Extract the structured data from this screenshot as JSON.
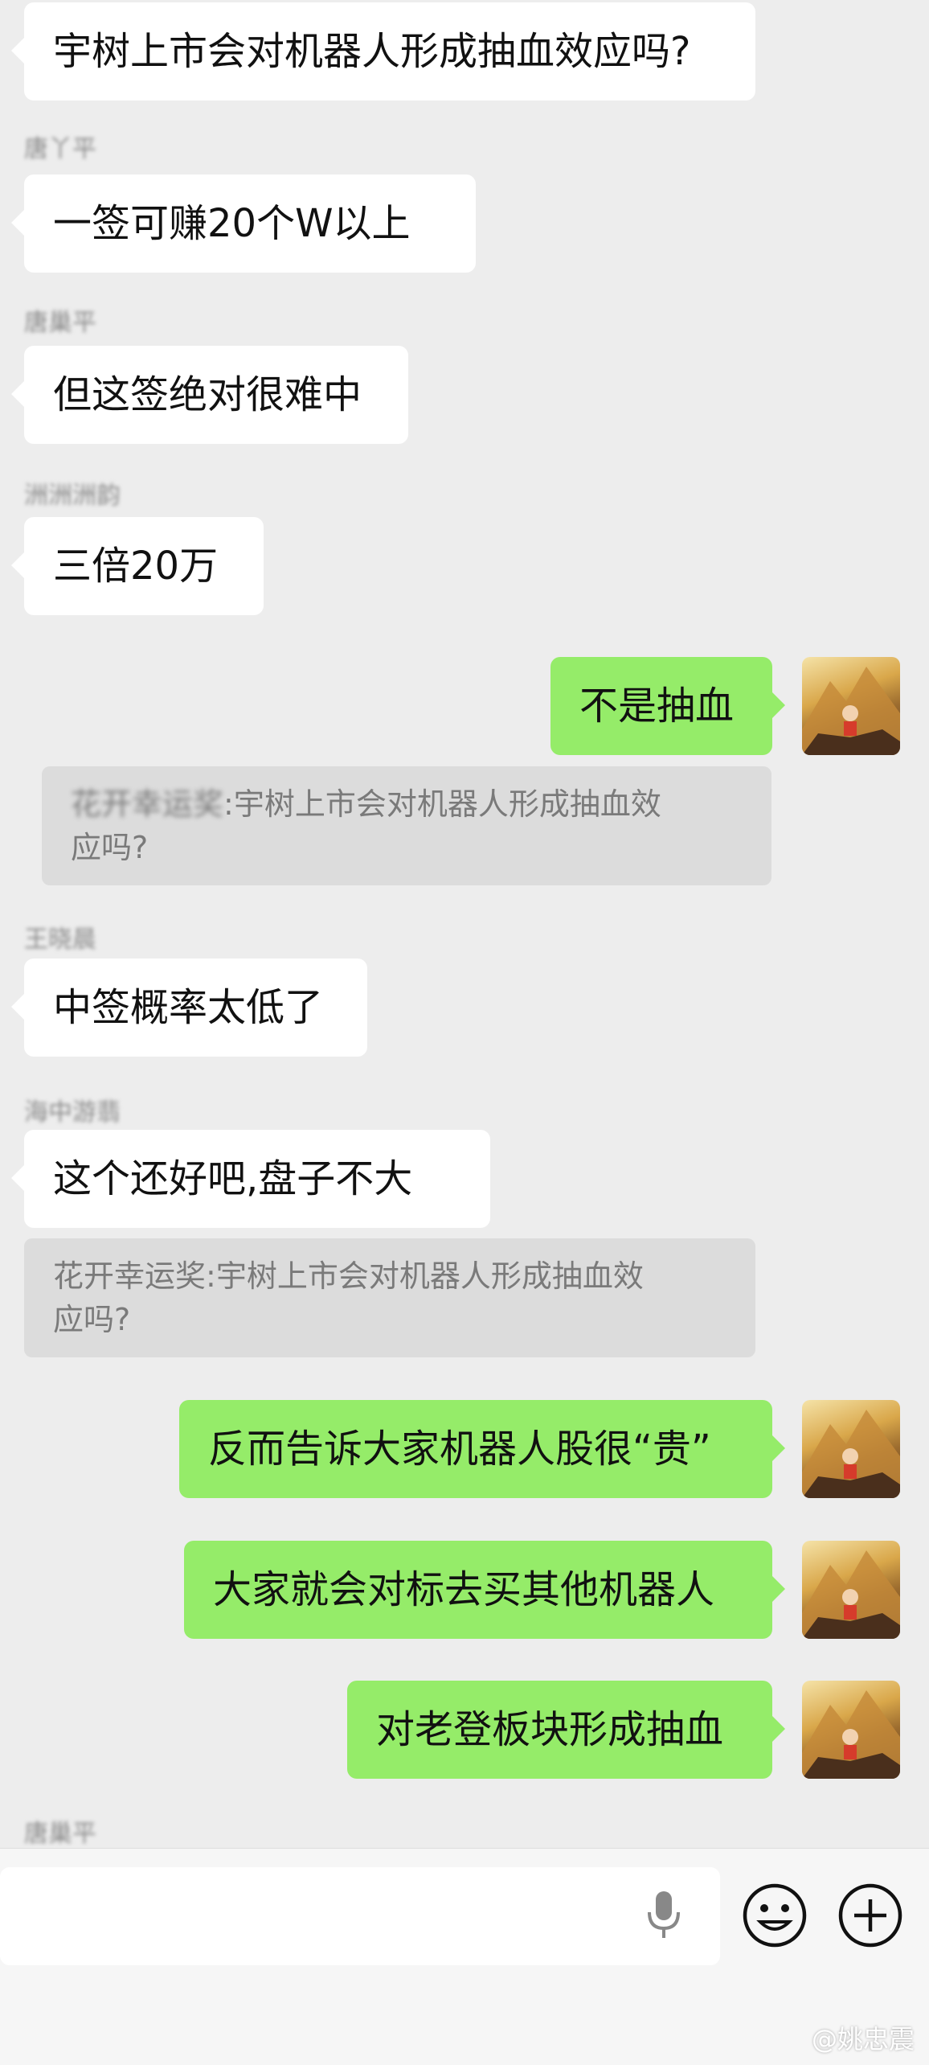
{
  "messages": [
    {
      "side": "left",
      "text": "宇树上市会对机器人形成抽血效应吗?"
    },
    {
      "side": "left",
      "sender": "唐丫平",
      "text": "一签可赚20个W以上"
    },
    {
      "side": "left",
      "sender": "唐巢平",
      "text": "但这签绝对很难中"
    },
    {
      "side": "left",
      "sender": "洲洲洲韵",
      "text": "三倍20万"
    },
    {
      "side": "right",
      "text": "不是抽血",
      "quote": {
        "name": "花开幸运奖",
        "sep": ":",
        "text_line1": "宇树上市会对机器人形成抽血效",
        "text_line2": "应吗?"
      }
    },
    {
      "side": "left",
      "sender": "王晓晨",
      "text": "中签概率太低了"
    },
    {
      "side": "left",
      "sender": "海中游翡",
      "text": "这个还好吧,盘子不大",
      "quote": {
        "name": "花开幸运奖",
        "sep": ":",
        "text_line1": "宇树上市会对机器人形成抽血效",
        "text_line2": "应吗?"
      }
    },
    {
      "side": "right",
      "text": "反而告诉大家机器人股很“贵”"
    },
    {
      "side": "right",
      "text": "大家就会对标去买其他机器人"
    },
    {
      "side": "right",
      "text": "对老登板块形成抽血"
    }
  ],
  "last_sender": "唐巢平",
  "input": {
    "placeholder": ""
  },
  "icons": {
    "voice": "microphone-icon",
    "emoji": "emoji-icon",
    "more": "plus-icon"
  },
  "watermark": "@姚忠震",
  "colors": {
    "bg": "#ededed",
    "left_bubble": "#ffffff",
    "right_bubble": "#95ec69"
  }
}
